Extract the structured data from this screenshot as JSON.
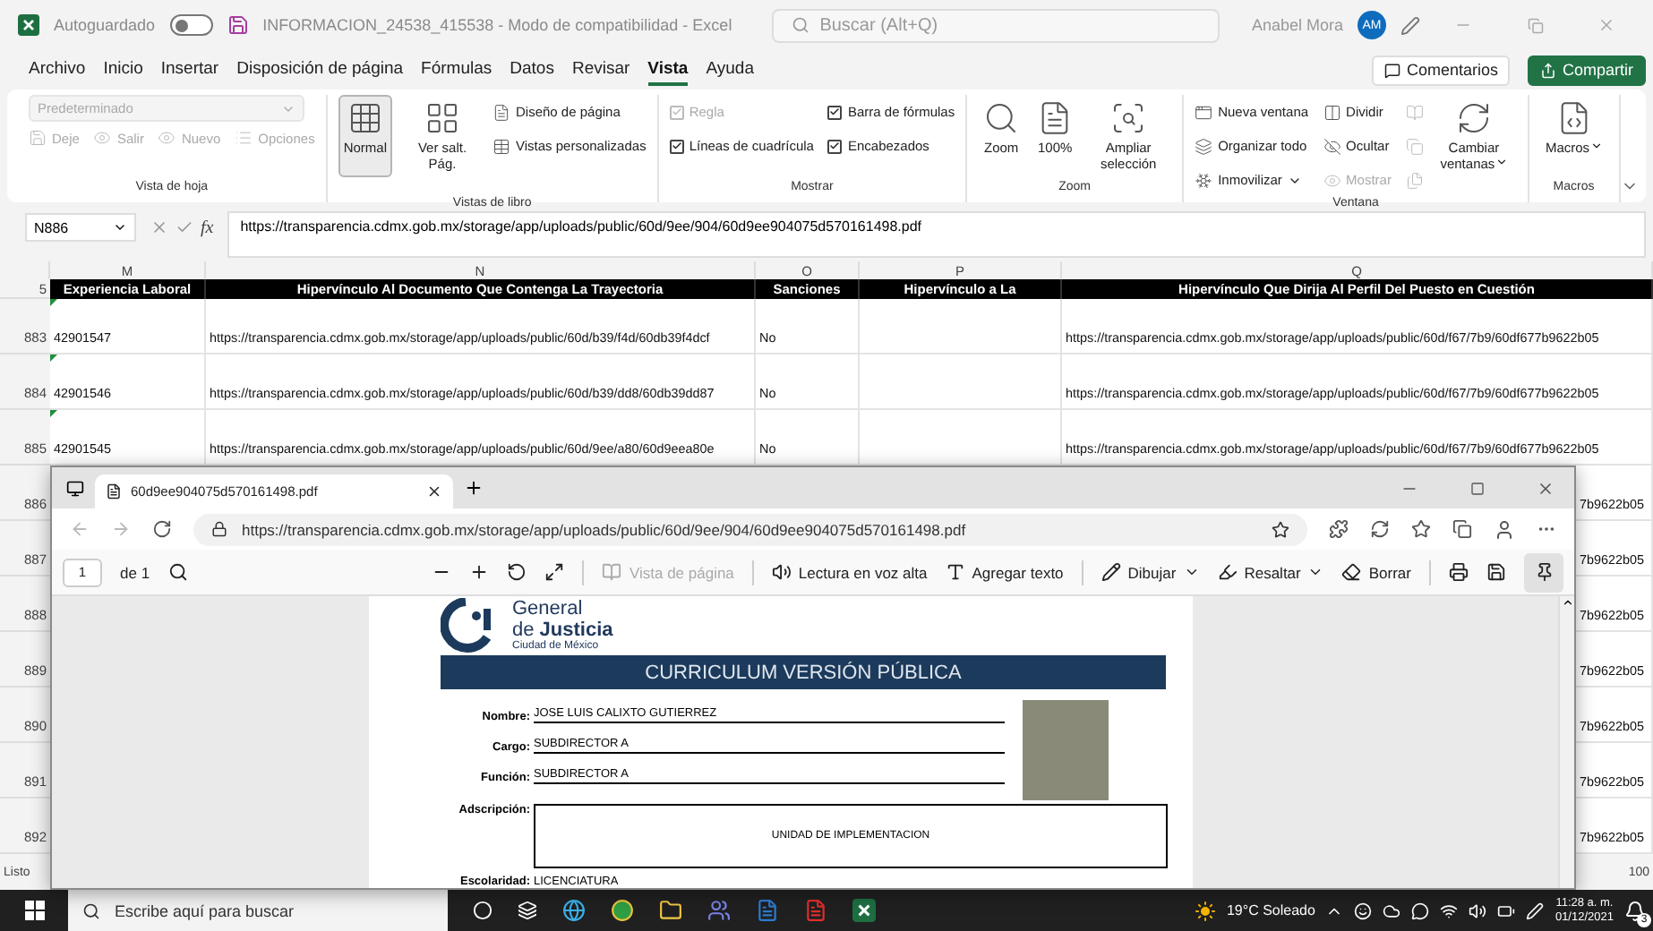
{
  "title_bar": {
    "autosave_label": "Autoguardado",
    "autosave_on": false,
    "file_title": "INFORMACION_24538_415538  -  Modo de compatibilidad  -  Excel",
    "search_placeholder": "Buscar (Alt+Q)",
    "user_name": "Anabel Mora",
    "avatar_initials": "AM"
  },
  "menu": [
    {
      "label": "Archivo",
      "selected": false
    },
    {
      "label": "Inicio",
      "selected": false
    },
    {
      "label": "Insertar",
      "selected": false
    },
    {
      "label": "Disposición de página",
      "selected": false
    },
    {
      "label": "Fórmulas",
      "selected": false
    },
    {
      "label": "Datos",
      "selected": false
    },
    {
      "label": "Revisar",
      "selected": false
    },
    {
      "label": "Vista",
      "selected": true
    },
    {
      "label": "Ayuda",
      "selected": false
    }
  ],
  "actions": {
    "comments": "Comentarios",
    "share": "Compartir"
  },
  "ribbon": [
    {
      "label": "Vista de hoja",
      "items": [
        {
          "kind": "dropdown",
          "label": "Predeterminado",
          "disabled": true
        },
        {
          "kind": "small",
          "label": "Deje",
          "disabled": true
        },
        {
          "kind": "small",
          "label": "Salir",
          "disabled": true
        },
        {
          "kind": "small",
          "label": "Nuevo",
          "disabled": true
        },
        {
          "kind": "small",
          "label": "Opciones",
          "disabled": true
        }
      ]
    },
    {
      "label": "Vistas de libro",
      "items": [
        {
          "kind": "large",
          "label": "Normal",
          "disabled": false,
          "selected": true
        },
        {
          "kind": "large",
          "label": "Ver salt. Pág.",
          "disabled": false,
          "selected": false
        },
        {
          "kind": "small",
          "label": "Diseño de página",
          "disabled": false
        },
        {
          "kind": "small",
          "label": "Vistas personalizadas",
          "disabled": false
        }
      ]
    },
    {
      "label": "Mostrar",
      "items": [
        {
          "kind": "check",
          "label": "Regla",
          "disabled": true,
          "checked": true
        },
        {
          "kind": "check",
          "label": "Líneas de cuadrícula",
          "disabled": false,
          "checked": true
        },
        {
          "kind": "check",
          "label": "Barra de fórmulas",
          "disabled": false,
          "checked": true
        },
        {
          "kind": "check",
          "label": "Encabezados",
          "disabled": false,
          "checked": true
        }
      ]
    },
    {
      "label": "Zoom",
      "items": [
        {
          "kind": "large",
          "label": "Zoom",
          "disabled": false
        },
        {
          "kind": "large",
          "label": "100%",
          "disabled": false
        },
        {
          "kind": "large",
          "label": "Ampliar selección",
          "disabled": false
        }
      ]
    },
    {
      "label": "Ventana",
      "items": [
        {
          "kind": "small",
          "label": "Nueva ventana",
          "disabled": false
        },
        {
          "kind": "small",
          "label": "Organizar todo",
          "disabled": false
        },
        {
          "kind": "small",
          "label": "Inmovilizar",
          "disabled": false,
          "caret": true
        },
        {
          "kind": "small",
          "label": "Dividir",
          "disabled": false
        },
        {
          "kind": "small",
          "label": "Ocultar",
          "disabled": false
        },
        {
          "kind": "small",
          "label": "Mostrar",
          "disabled": true
        },
        {
          "kind": "mini",
          "disabled": true
        },
        {
          "kind": "mini",
          "disabled": true
        },
        {
          "kind": "mini",
          "disabled": true
        },
        {
          "kind": "large",
          "label": "Cambiar ventanas",
          "disabled": false,
          "caret": true
        }
      ]
    },
    {
      "label": "Macros",
      "items": [
        {
          "kind": "large",
          "label": "Macros",
          "disabled": false,
          "caret": true
        }
      ]
    }
  ],
  "formula_bar": {
    "name_box": "N886",
    "function_label": "fx",
    "formula": "https://transparencia.cdmx.gob.mx/storage/app/uploads/public/60d/9ee/904/60d9ee904075d570161498.pdf"
  },
  "sheet": {
    "columns": [
      "M",
      "N",
      "O",
      "P",
      "Q"
    ],
    "header": {
      "number": "5",
      "cells": [
        "Experiencia Laboral",
        "Hipervínculo Al Documento Que Contenga La Trayectoria",
        "Sanciones",
        "Hipervínculo a La",
        "Hipervínculo Que Dirija Al Perfil Del Puesto en Cuestión"
      ]
    },
    "rows": [
      {
        "number": "883",
        "flagged": true,
        "M": "42901547",
        "N": "https://transparencia.cdmx.gob.mx/storage/app/uploads/public/60d/b39/f4d/60db39f4dcf",
        "O": "No",
        "Q": "https://transparencia.cdmx.gob.mx/storage/app/uploads/public/60d/f67/7b9/60df677b9622b05"
      },
      {
        "number": "884",
        "flagged": true,
        "M": "42901546",
        "N": "https://transparencia.cdmx.gob.mx/storage/app/uploads/public/60d/b39/dd8/60db39dd87",
        "O": "No",
        "Q": "https://transparencia.cdmx.gob.mx/storage/app/uploads/public/60d/f67/7b9/60df677b9622b05"
      },
      {
        "number": "885",
        "flagged": true,
        "M": "42901545",
        "N": "https://transparencia.cdmx.gob.mx/storage/app/uploads/public/60d/9ee/a80/60d9eea80e",
        "O": "No",
        "Q": "https://transparencia.cdmx.gob.mx/storage/app/uploads/public/60d/f67/7b9/60df677b9622b05"
      }
    ],
    "covered_rows": [
      {
        "number": "886",
        "Q": "7b9622b05"
      },
      {
        "number": "887",
        "Q": "7b9622b05"
      },
      {
        "number": "888",
        "Q": "7b9622b05"
      },
      {
        "number": "889",
        "Q": "7b9622b05"
      },
      {
        "number": "890",
        "Q": "7b9622b05"
      },
      {
        "number": "891",
        "Q": "7b9622b05"
      },
      {
        "number": "892",
        "Q": "7b9622b05"
      }
    ]
  },
  "status_bar": {
    "status": "Listo",
    "zoom": "100"
  },
  "browser": {
    "tab_title": "60d9ee904075d570161498.pdf",
    "url": "https://transparencia.cdmx.gob.mx/storage/app/uploads/public/60d/9ee/904/60d9ee904075d570161498.pdf",
    "pdf_toolbar": {
      "page": "1",
      "page_count": "de 1",
      "pinned": true,
      "tools": [
        {
          "label": "Vista de página",
          "disabled": true,
          "caret": false
        },
        {
          "label": "Lectura en voz alta",
          "disabled": false,
          "caret": false
        },
        {
          "label": "Agregar texto",
          "disabled": false,
          "caret": false
        },
        {
          "label": "Dibujar",
          "disabled": false,
          "caret": true
        },
        {
          "label": "Resaltar",
          "disabled": false,
          "caret": true
        },
        {
          "label": "Borrar",
          "disabled": false,
          "caret": false
        }
      ]
    },
    "document": {
      "org_lines": [
        "General",
        "de **Justicia**",
        "Ciudad de México"
      ],
      "banner": "CURRICULUM VERSIÓN PÚBLICA",
      "fields": [
        {
          "label": "Nombre:",
          "value": "JOSE LUIS CALIXTO GUTIERREZ"
        },
        {
          "label": "Cargo:",
          "value": "SUBDIRECTOR  A"
        },
        {
          "label": "Función:",
          "value": "SUBDIRECTOR  A"
        }
      ],
      "assignment_label": "Adscripción:",
      "assignment_value": "UNIDAD DE IMPLEMENTACION",
      "education_label": "Escolaridad:",
      "education_value": "LICENCIATURA"
    }
  },
  "taskbar": {
    "search_placeholder": "Escribe aquí para buscar",
    "weather": "19°C Soleado",
    "time": "11:28 a. m.",
    "date": "01/12/2021",
    "notifications": "3"
  }
}
